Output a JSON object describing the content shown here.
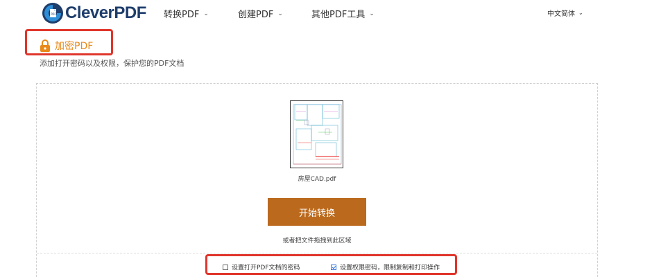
{
  "header": {
    "logo_text": "CleverPDF",
    "nav": [
      {
        "label": "转换PDF"
      },
      {
        "label": "创建PDF"
      },
      {
        "label": "其他PDF工具"
      }
    ],
    "language": "中文简体"
  },
  "tool": {
    "title": "加密PDF",
    "subtitle": "添加打开密码以及权限，保护您的PDF文档"
  },
  "upload": {
    "file_name": "房屋CAD.pdf",
    "start_button": "开始转换",
    "drop_hint": "或者把文件拖拽到此区域"
  },
  "options": {
    "open_password": {
      "label": "设置打开PDF文档的密码",
      "checked": false
    },
    "permission_password": {
      "label": "设置权限密码，限制复制和打印操作",
      "checked": true
    }
  },
  "colors": {
    "accent": "#e8891a",
    "button": "#bb6a1d",
    "annotation": "#e0352b",
    "brand": "#1e3d6b"
  }
}
